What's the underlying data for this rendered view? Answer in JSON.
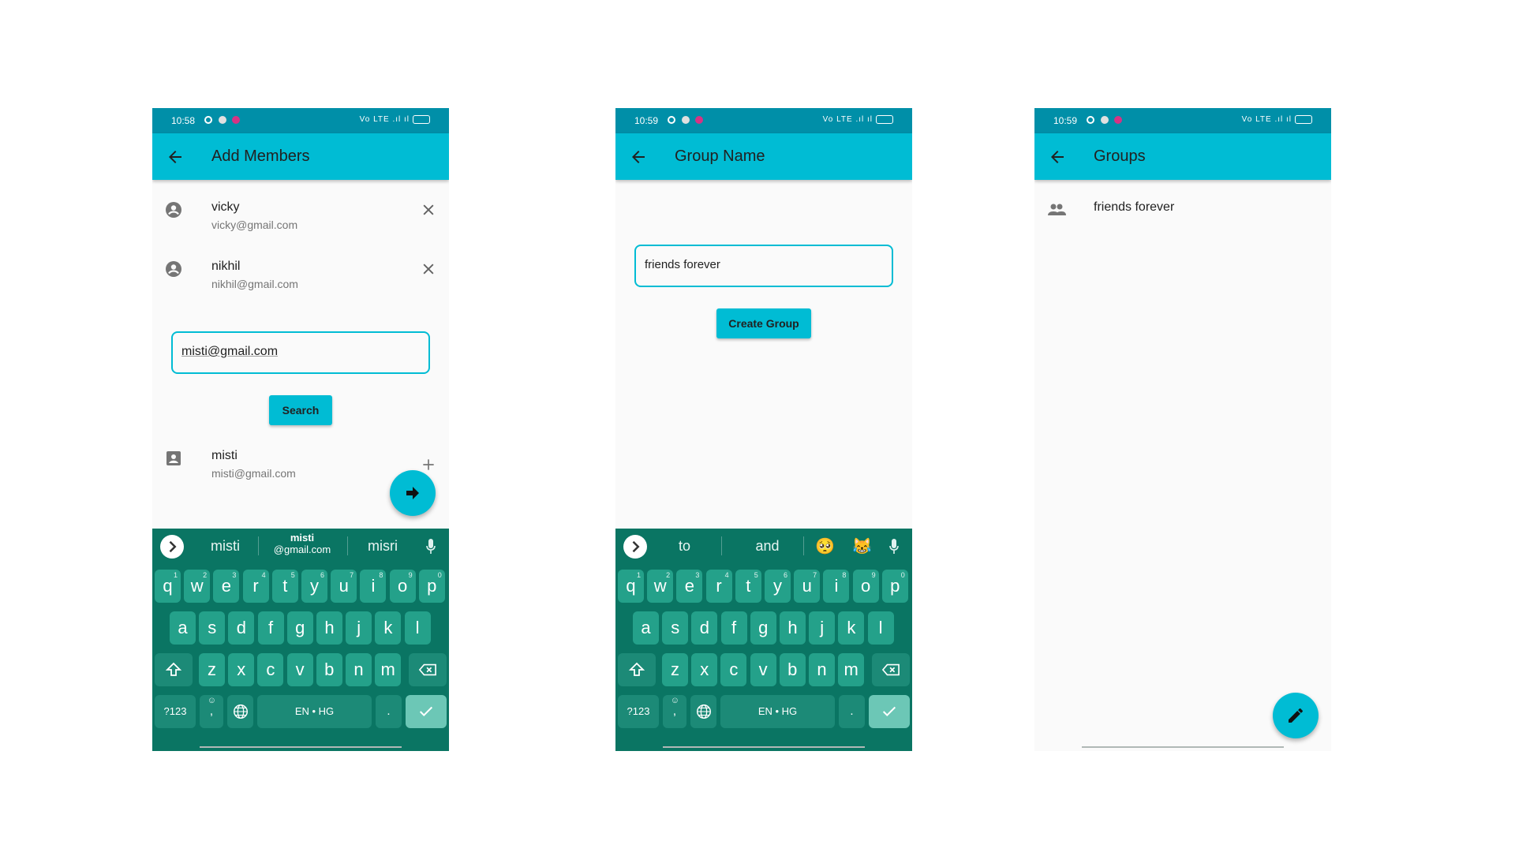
{
  "colors": {
    "primary": "#00bcd4",
    "status_bar": "#008fa8",
    "keyboard_bg": "#0a7563",
    "key": "#24a18a",
    "background": "#fafafa"
  },
  "status_bar": {
    "screen1_time": "10:58",
    "screen2_time": "10:59",
    "screen3_time": "10:59",
    "network_text": "Vo LTE .ıl ıl"
  },
  "screen1": {
    "title": "Add Members",
    "members": [
      {
        "name": "vicky",
        "email": "vicky@gmail.com",
        "icon": "account-circle-icon",
        "action_icon": "close-icon"
      },
      {
        "name": "nikhil",
        "email": "nikhil@gmail.com",
        "icon": "account-circle-icon",
        "action_icon": "close-icon"
      }
    ],
    "search_value": "misti@gmail.com",
    "search_button": "Search",
    "result": {
      "name": "misti",
      "email": "misti@gmail.com",
      "icon": "account-box-icon",
      "action_icon": "add-icon"
    },
    "fab_icon": "arrow-forward-icon"
  },
  "screen2": {
    "title": "Group Name",
    "group_name_value": "friends forever",
    "create_button": "Create Group"
  },
  "screen3": {
    "title": "Groups",
    "groups": [
      {
        "name": "friends forever",
        "icon": "group-icon"
      }
    ],
    "fab_icon": "edit-icon"
  },
  "keyboard1": {
    "suggestions": {
      "left": "misti",
      "middle_top": "misti",
      "middle_bottom": "@gmail.com",
      "right": "misri"
    }
  },
  "keyboard2": {
    "suggestions": {
      "left": "to",
      "middle": "and",
      "emoji1": "🥺",
      "emoji2": "😹"
    }
  },
  "keyboard_keys": {
    "row1": [
      "q",
      "w",
      "e",
      "r",
      "t",
      "y",
      "u",
      "i",
      "o",
      "p"
    ],
    "row1_hints": [
      "1",
      "2",
      "3",
      "4",
      "5",
      "6",
      "7",
      "8",
      "9",
      "0"
    ],
    "row2": [
      "a",
      "s",
      "d",
      "f",
      "g",
      "h",
      "j",
      "k",
      "l"
    ],
    "row3": [
      "z",
      "x",
      "c",
      "v",
      "b",
      "n",
      "m"
    ],
    "sym_key": "?123",
    "comma_key": ",",
    "emoji_hint": "☺",
    "space_label": "EN • HG",
    "period_key": "."
  }
}
